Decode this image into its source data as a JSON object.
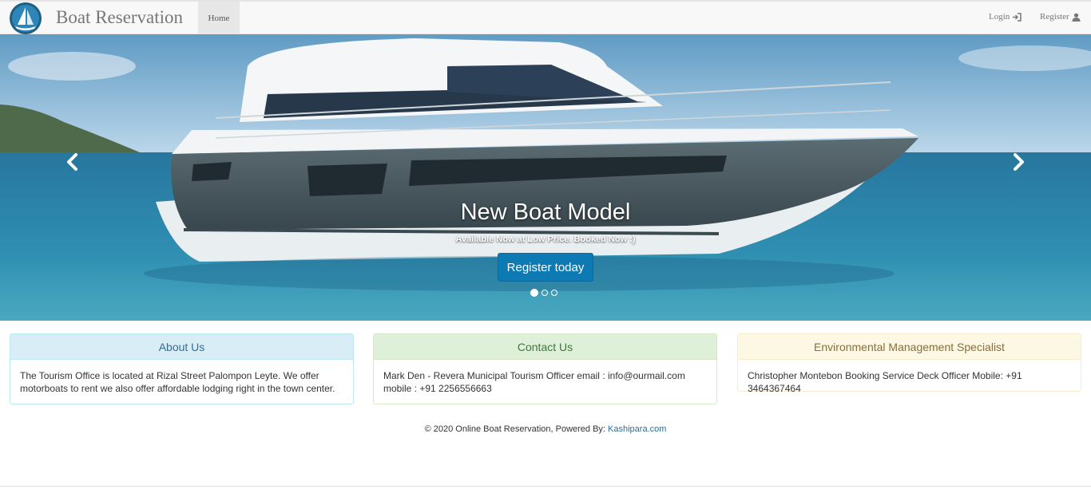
{
  "navbar": {
    "brand": "Boat Reservation",
    "home_label": "Home",
    "login_label": "Login",
    "register_label": "Register",
    "logo_icon": "sailboat-logo-icon",
    "login_icon": "sign-in-icon",
    "register_icon": "user-icon"
  },
  "hero": {
    "title": "New Boat Model",
    "subtitle": "Available Now at Low Price. Booked Now :)",
    "button_label": "Register today",
    "prev_icon": "chevron-left-icon",
    "next_icon": "chevron-right-icon",
    "slides": 3,
    "active_slide": 1
  },
  "panels": [
    {
      "title": "About Us",
      "body": "The Tourism Office is located at Rizal Street Palompon Leyte. We offer motorboats to rent we also offer affordable lodging right in the town center.",
      "color": "#d9edf7"
    },
    {
      "title": "Contact Us",
      "body": "Mark Den - Revera Municipal Tourism Officer email : info@ourmail.com mobile : +91 2256556663",
      "color": "#dff0d8"
    },
    {
      "title": "Environmental Management Specialist",
      "body": "Christopher Montebon Booking Service Deck Officer Mobile: +91 3464367464",
      "color": "#fcf8e3"
    }
  ],
  "footer": {
    "text": "© 2020 Online Boat Reservation, Powered By: ",
    "link": "Kashipara.com"
  },
  "colors": {
    "primary_button": "#0d7ab3",
    "link": "#23719f"
  }
}
